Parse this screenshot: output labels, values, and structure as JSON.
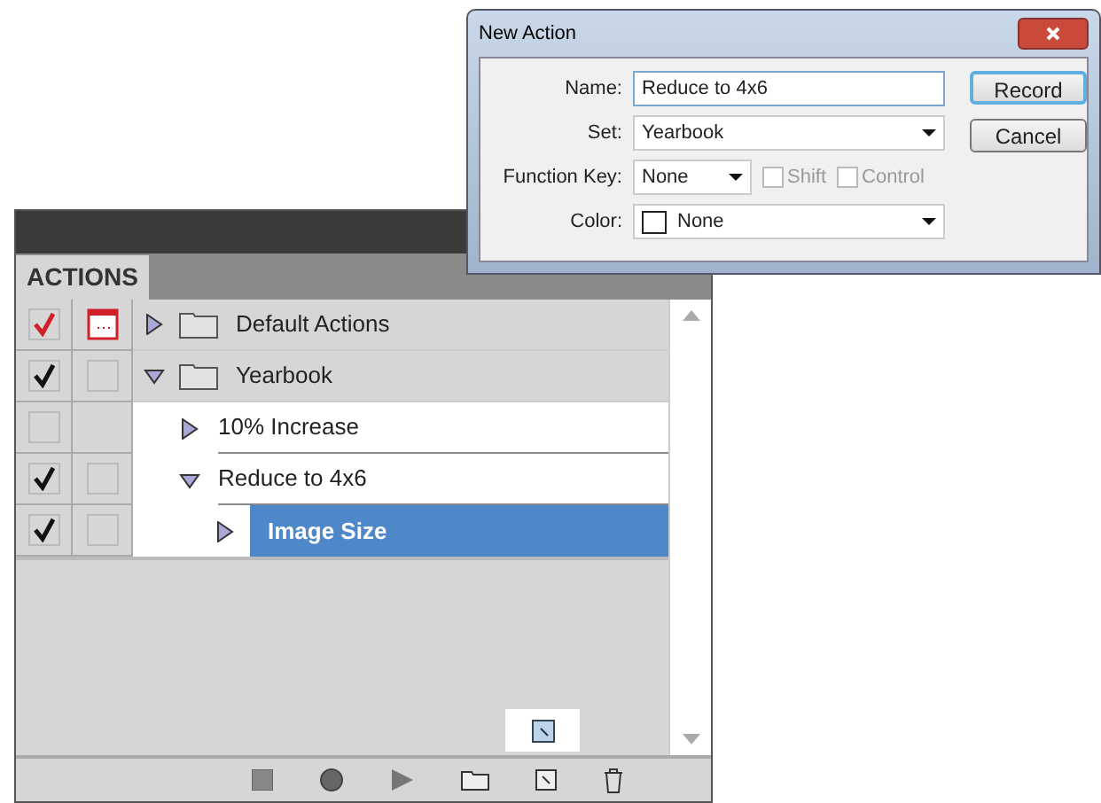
{
  "actions_panel": {
    "tab": "ACTIONS",
    "items": [
      {
        "kind": "set",
        "label": "Default Actions",
        "checked": true,
        "mixed": true,
        "dialog": {
          "checked": true,
          "mixed": true
        },
        "expanded": false,
        "selected": false
      },
      {
        "kind": "set",
        "label": "Yearbook",
        "checked": true,
        "mixed": false,
        "dialog": {
          "checked": false,
          "mixed": false
        },
        "expanded": true,
        "selected": false,
        "children": [
          {
            "kind": "action",
            "label": "10% Increase",
            "checked": false,
            "mixed": false,
            "expanded": false,
            "selected": false
          },
          {
            "kind": "action",
            "label": "Reduce to 4x6",
            "checked": true,
            "mixed": false,
            "dialog": {
              "checked": false,
              "mixed": false
            },
            "expanded": true,
            "selected": false,
            "children": [
              {
                "kind": "command",
                "label": "Image Size",
                "checked": true,
                "mixed": false,
                "dialog": {
                  "checked": false,
                  "mixed": false
                },
                "expanded": false,
                "selected": true
              }
            ]
          }
        ]
      }
    ]
  },
  "dialog": {
    "title": "New Action",
    "name": {
      "label": "Name:",
      "value": "Reduce to 4x6"
    },
    "set": {
      "label": "Set:",
      "value": "Yearbook"
    },
    "function_key": {
      "label": "Function Key:",
      "value": "None"
    },
    "modifiers": [
      {
        "label": "Shift",
        "checked": false,
        "disabled": true
      },
      {
        "label": "Control",
        "checked": false,
        "disabled": true
      }
    ],
    "color": {
      "label": "Color:",
      "value": "None"
    },
    "buttons": [
      {
        "label": "Record",
        "default": true
      },
      {
        "label": "Cancel",
        "default": false
      }
    ]
  }
}
